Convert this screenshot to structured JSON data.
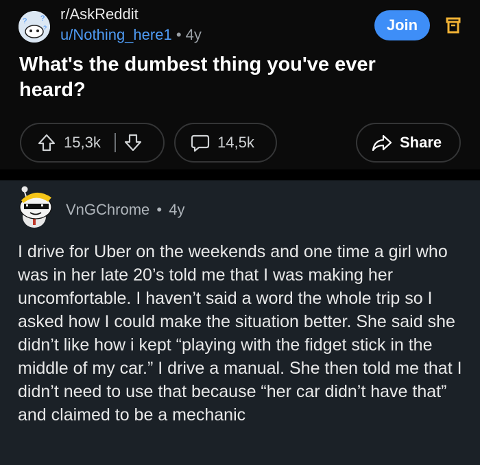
{
  "post": {
    "subreddit": "r/AskReddit",
    "author": "u/Nothing_here1",
    "separator": "•",
    "age": "4y",
    "join_label": "Join",
    "title": "What's the dumbest thing you've ever heard?",
    "upvotes": "15,3k",
    "comments": "14,5k",
    "share_label": "Share"
  },
  "comment": {
    "author": "VnGChrome",
    "separator": "•",
    "age": "4y",
    "body": "I drive for Uber on the weekends and one time a girl who was in her late 20’s told me that I was making her uncomfortable. I haven’t said a word the whole trip so I asked how I could make the situation better. She said she didn’t like how i kept “playing with the fidget stick in the middle of my car.” I drive a manual. She then told me that I didn’t need to use that because “her car didn’t have that” and claimed to be a mechanic"
  },
  "colors": {
    "join": "#3e8ef7",
    "author_link": "#4f9cf5",
    "save_icon": "#f2b335",
    "comment_bg": "#1b2127"
  },
  "icons": [
    "subreddit-avatar",
    "bookmark-icon",
    "upvote-icon",
    "downvote-icon",
    "comment-icon",
    "share-icon",
    "user-avatar"
  ]
}
